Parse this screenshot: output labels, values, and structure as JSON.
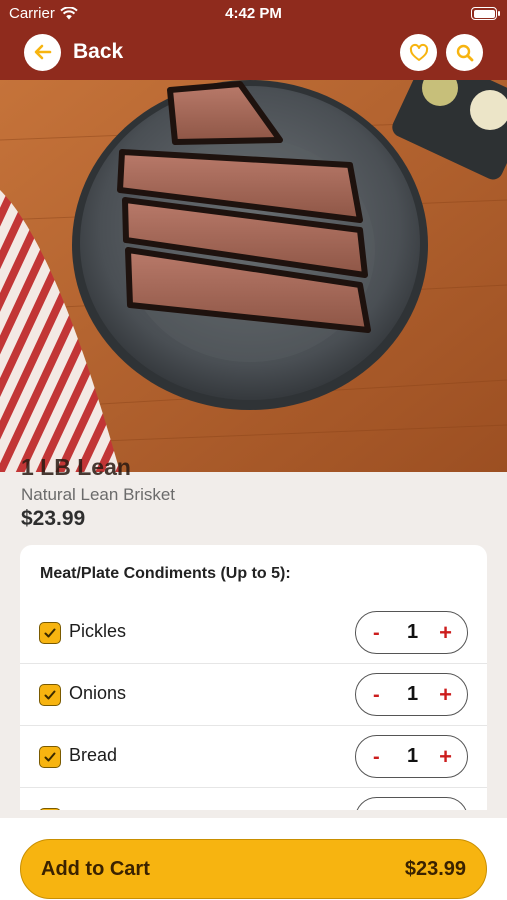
{
  "status_bar": {
    "carrier": "Carrier",
    "time": "4:42 PM"
  },
  "header": {
    "back_label": "Back"
  },
  "product": {
    "name": "1 LB Lean",
    "description": "Natural Lean Brisket",
    "price": "$23.99"
  },
  "options": {
    "title": "Meat/Plate Condiments (Up to 5):",
    "items": [
      {
        "label": "Pickles",
        "checked": true,
        "quantity": "1"
      },
      {
        "label": "Onions",
        "checked": true,
        "quantity": "1"
      },
      {
        "label": "Bread",
        "checked": true,
        "quantity": "1"
      }
    ],
    "minus": "-",
    "plus": "+"
  },
  "cart": {
    "label": "Add to Cart",
    "price": "$23.99"
  },
  "colors": {
    "header_bg": "#8f2b1d",
    "accent": "#f7b410",
    "stepper_symbol": "#cc1d1d"
  },
  "icons": [
    "wifi-icon",
    "battery-icon",
    "back-arrow-icon",
    "heart-icon",
    "search-icon",
    "checkmark-icon"
  ]
}
